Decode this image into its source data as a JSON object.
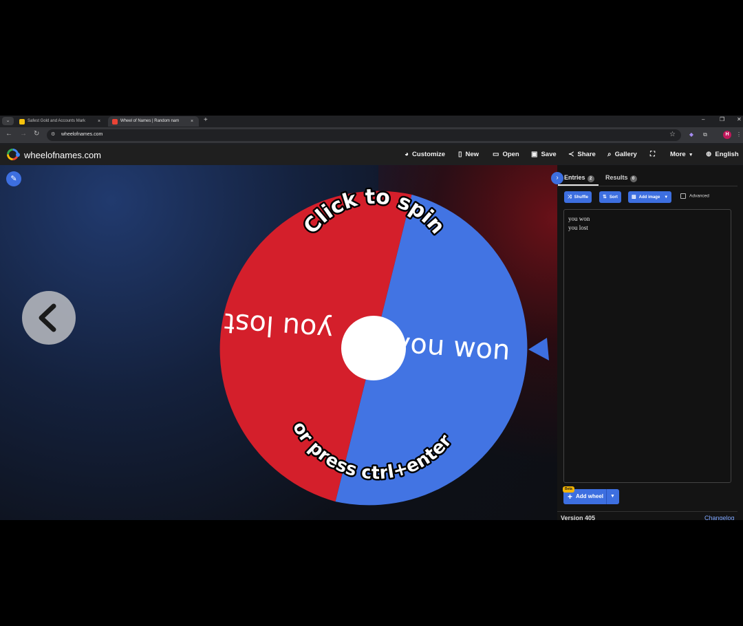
{
  "browser": {
    "tabs": [
      {
        "title": "Safest Gold and Accounts Mark",
        "active": false,
        "favicon_color": "#f4c20d"
      },
      {
        "title": "Wheel of Names | Random nam",
        "active": true,
        "favicon_color": "#ea4335"
      }
    ],
    "close_glyph": "×",
    "new_tab": "+",
    "url": "wheelofnames.com",
    "profile_initial": "H"
  },
  "site": {
    "title": "wheelofnames.com",
    "menu": [
      {
        "label": "Customize",
        "icon": "palette-icon"
      },
      {
        "label": "New",
        "icon": "file-icon"
      },
      {
        "label": "Open",
        "icon": "folder-icon"
      },
      {
        "label": "Save",
        "icon": "save-icon"
      },
      {
        "label": "Share",
        "icon": "share-icon"
      },
      {
        "label": "Gallery",
        "icon": "search-icon"
      },
      {
        "label": "",
        "icon": "fullscreen-icon"
      },
      {
        "label": "More",
        "icon": "chevron-down-icon"
      },
      {
        "label": "English",
        "icon": "globe-icon"
      }
    ]
  },
  "wheel": {
    "center_text_top": "Click to spin",
    "center_text_bottom": "or press ctrl+enter",
    "segments": [
      {
        "label": "you won",
        "color": "#4274e3"
      },
      {
        "label": "you lost",
        "color": "#d41f2b"
      }
    ],
    "pointer_color": "#3d6fe0"
  },
  "panel": {
    "tabs": [
      {
        "label": "Entries",
        "count": "2"
      },
      {
        "label": "Results",
        "count": "0"
      }
    ],
    "buttons": {
      "shuffle": "Shuffle",
      "sort": "Sort",
      "add_image": "Add image",
      "advanced": "Advanced"
    },
    "entries": [
      "you won",
      "you lost"
    ],
    "beta_badge": "Beta",
    "add_wheel": "Add wheel",
    "version": "Version 405",
    "changelog": "Changelog"
  },
  "colors": {
    "accent": "#3d6fe0",
    "wheel_red": "#d41f2b",
    "wheel_blue": "#4274e3"
  }
}
